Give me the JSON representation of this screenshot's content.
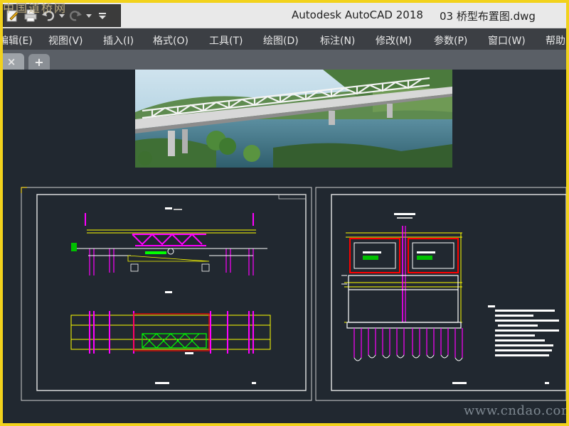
{
  "window": {
    "watermark_top": "中国道桥网",
    "app_title": "Autodesk AutoCAD 2018",
    "file_title": "03 桥型布置图.dwg"
  },
  "quick_access": {
    "icons": [
      "edit-icon",
      "print-icon",
      "undo-icon",
      "dropdown-icon",
      "redo-icon",
      "dropdown-icon",
      "customize-icon"
    ]
  },
  "menubar": {
    "items": [
      "编辑(E)",
      "视图(V)",
      "插入(I)",
      "格式(O)",
      "工具(T)",
      "绘图(D)",
      "标注(N)",
      "修改(M)",
      "参数(P)",
      "窗口(W)",
      "帮助"
    ]
  },
  "tabs": {
    "close_label": "×",
    "add_label": "+"
  },
  "drawing": {
    "watermark_bottom": "www.cndao.com"
  },
  "colors": {
    "frame": "#f2d21c",
    "canvas_bg": "#212830",
    "menubar_bg": "#3c3f44",
    "cad_magenta": "#ff00ff",
    "cad_yellow": "#ffff00",
    "cad_green": "#00ff00",
    "cad_red": "#ff0000",
    "cad_white": "#ffffff"
  }
}
